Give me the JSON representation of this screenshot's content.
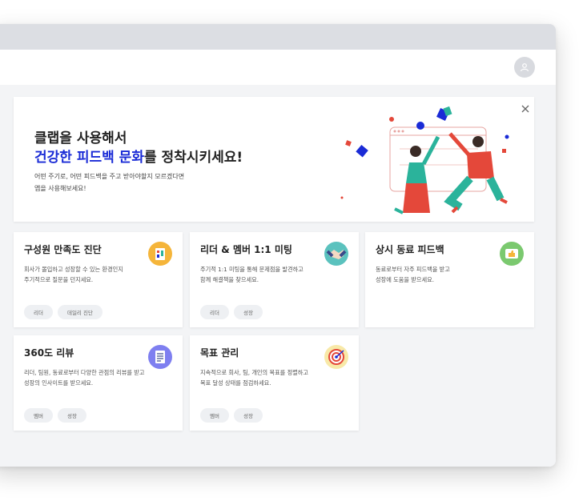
{
  "banner": {
    "title_line1": "클랩을 사용해서",
    "title_highlight": "건강한 피드백 문화",
    "title_rest": "를 정착시키세요!",
    "desc_line1": "어떤 주기로, 어떤 피드백을 주고 받아야할지 모르겠다면",
    "desc_line2": "앱을 사용해보세요!"
  },
  "cards": [
    {
      "title": "구성원 만족도 진단",
      "desc1": "회사가 몰입하고 성장할 수 있는 환경인지",
      "desc2": "주기적으로 질문을 던지세요.",
      "tags": [
        "리더",
        "데일리 진단"
      ],
      "icon": "survey-icon"
    },
    {
      "title": "리더 & 멤버 1:1 미팅",
      "desc1": "주기적 1:1 미팅을 통해 문제점을 발견하고",
      "desc2": "함께 해결책을 찾으세요.",
      "tags": [
        "리더",
        "성장"
      ],
      "icon": "handshake-icon"
    },
    {
      "title": "상시 동료 피드백",
      "desc1": "동료로부터 자주 피드백을 받고",
      "desc2": "성장에 도움을 받으세요.",
      "tags": [],
      "icon": "thumbs-up-icon"
    },
    {
      "title": "360도 리뷰",
      "desc1": "리더, 팀원, 동료로부터 다양한 관점의 리뷰를 받고",
      "desc2": "성장의 인사이트를 받으세요.",
      "tags": [
        "멤버",
        "성장"
      ],
      "icon": "document-icon"
    },
    {
      "title": "목표 관리",
      "desc1": "지속적으로 회사, 팀, 개인의 목표를 정렬하고",
      "desc2": "목표 달성 상태를 점검하세요.",
      "tags": [
        "멤버",
        "성장"
      ],
      "icon": "target-icon"
    }
  ],
  "colors": {
    "accent": "#1a2bd6",
    "icon_bg_survey": "#f5b53a",
    "icon_bg_handshake": "#5bc2be",
    "icon_bg_thumbs": "#7bc96f",
    "icon_bg_document": "#7e7ff0",
    "icon_bg_target": "#f8e9a8"
  }
}
